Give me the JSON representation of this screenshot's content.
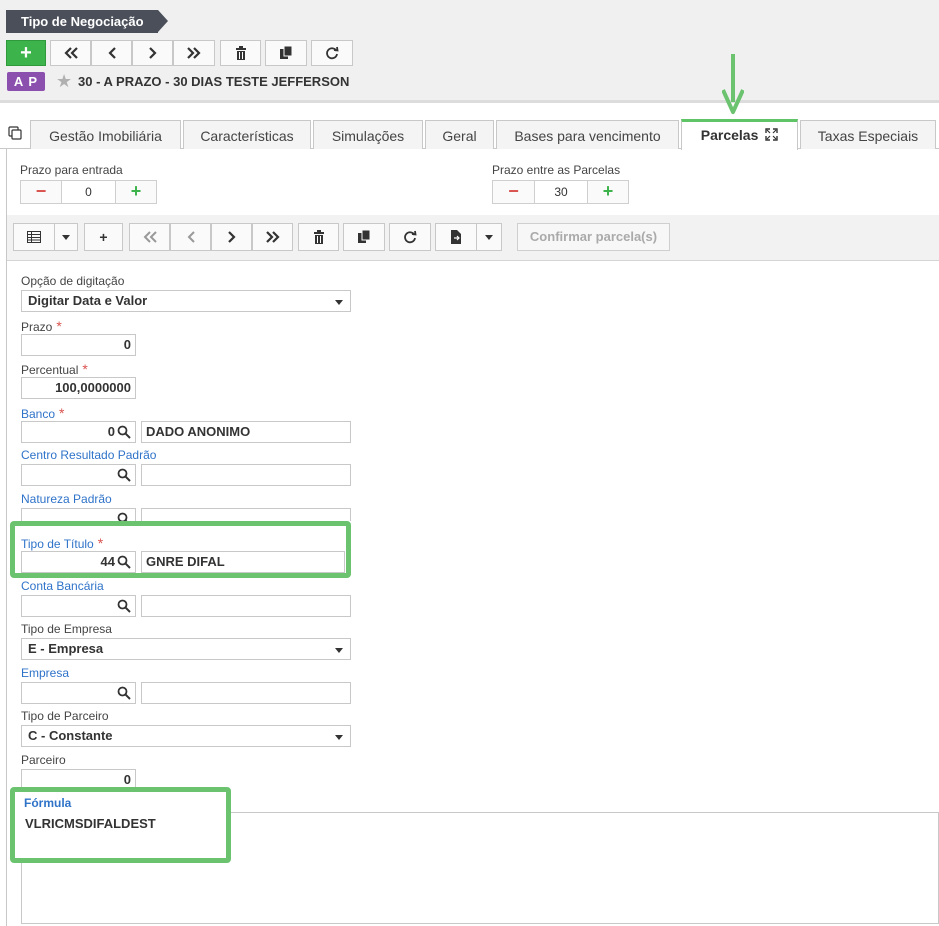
{
  "header": {
    "breadcrumb": "Tipo de Negociação",
    "badge": "A P",
    "record_title": "30 - A PRAZO - 30 DIAS TESTE JEFFERSON"
  },
  "tabs": [
    {
      "label": "Gestão Imobiliária"
    },
    {
      "label": "Características"
    },
    {
      "label": "Simulações"
    },
    {
      "label": "Geral"
    },
    {
      "label": "Bases para vencimento"
    },
    {
      "label": "Parcelas"
    },
    {
      "label": "Taxas Especiais"
    }
  ],
  "active_tab": "Parcelas",
  "steppers": {
    "entrada": {
      "label": "Prazo para entrada",
      "value": "0"
    },
    "parcelas": {
      "label": "Prazo entre as Parcelas",
      "value": "30"
    }
  },
  "toolbar2": {
    "confirm_label": "Confirmar parcela(s)"
  },
  "form": {
    "opcao": {
      "label": "Opção de digitação",
      "value": "Digitar Data e Valor"
    },
    "prazo": {
      "label": "Prazo",
      "value": "0"
    },
    "percentual": {
      "label": "Percentual",
      "value": "100,0000000"
    },
    "banco": {
      "label": "Banco",
      "code": "0",
      "desc": "DADO ANONIMO"
    },
    "centro": {
      "label": "Centro Resultado Padrão",
      "code": "",
      "desc": ""
    },
    "natureza": {
      "label": "Natureza Padrão",
      "code": "",
      "desc": ""
    },
    "tipo_titulo": {
      "label": "Tipo de Título",
      "code": "44",
      "desc": "GNRE DIFAL"
    },
    "conta": {
      "label": "Conta Bancária",
      "code": "",
      "desc": ""
    },
    "tipo_empresa": {
      "label": "Tipo de Empresa",
      "value": "E - Empresa"
    },
    "empresa": {
      "label": "Empresa",
      "code": "",
      "desc": ""
    },
    "tipo_parceiro": {
      "label": "Tipo de Parceiro",
      "value": "C - Constante"
    },
    "parceiro": {
      "label": "Parceiro",
      "value": "0"
    },
    "formula": {
      "label": "Fórmula",
      "value": "VLRICMSDIFALDEST"
    }
  },
  "colors": {
    "accent_green": "#3cb44b",
    "highlight_green": "#6cc36f",
    "badge_purple": "#8b4fae",
    "link_blue": "#2f73c9",
    "required_red": "#d9534f"
  }
}
